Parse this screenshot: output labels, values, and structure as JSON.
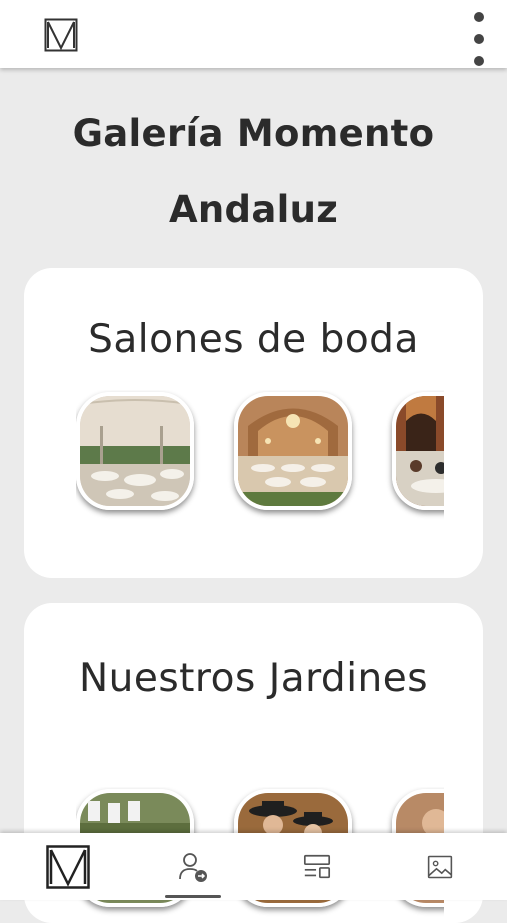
{
  "app": {
    "title": "Galería Momento Andaluz"
  },
  "header": {
    "logo_icon": "monogram-logo-icon",
    "menu_icon": "more-vertical-icon"
  },
  "sections": [
    {
      "title": "Salones de boda",
      "images": [
        "wedding-tent-hall-photo",
        "ornate-ballroom-photo",
        "courtyard-guests-photo"
      ]
    },
    {
      "title": "Nuestros Jardines",
      "images": [
        "garden-photo",
        "riders-with-hats-photo",
        "garden-guest-photo"
      ]
    }
  ],
  "bottom_nav": {
    "items": [
      {
        "icon": "monogram-logo-icon"
      },
      {
        "icon": "user-arrow-icon",
        "active": true
      },
      {
        "icon": "layout-list-icon"
      },
      {
        "icon": "image-gallery-icon"
      }
    ]
  },
  "colors": {
    "background": "#ebebeb",
    "card": "#ffffff",
    "text": "#2b2b2b",
    "icon": "#444444"
  }
}
